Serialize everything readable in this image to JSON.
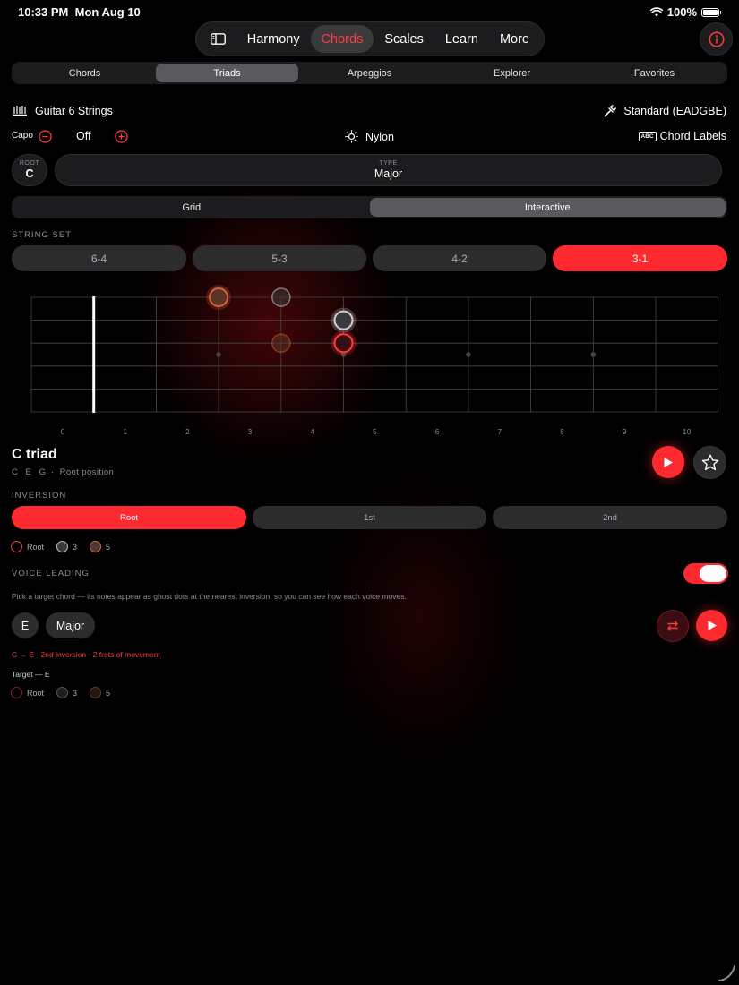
{
  "status": {
    "time": "10:33 PM",
    "date": "Mon Aug 10",
    "battery": "100%"
  },
  "nav": {
    "sidebar_icon": "sidebar-icon",
    "tabs": [
      "Harmony",
      "Chords",
      "Scales",
      "Learn",
      "More"
    ],
    "active": "Chords",
    "info_icon": "info-icon"
  },
  "subtabs": {
    "items": [
      "Chords",
      "Triads",
      "Arpeggios",
      "Explorer",
      "Favorites"
    ],
    "active": "Triads"
  },
  "instrument": {
    "label": "Guitar 6 Strings",
    "tuning": "Standard (EADGBE)"
  },
  "capo": {
    "label": "Capo",
    "value": "Off"
  },
  "string_type": "Nylon",
  "chord_labels": {
    "badge": "ABC",
    "label": "Chord Labels"
  },
  "root": {
    "label": "ROOT",
    "value": "C"
  },
  "type": {
    "label": "TYPE",
    "value": "Major"
  },
  "view_mode": {
    "items": [
      "Grid",
      "Interactive"
    ],
    "active": "Interactive"
  },
  "string_set": {
    "label": "STRING SET",
    "items": [
      "6-4",
      "5-3",
      "4-2",
      "3-1"
    ],
    "active": "3-1"
  },
  "fretboard": {
    "fret_numbers": [
      "0",
      "1",
      "2",
      "3",
      "4",
      "5",
      "6",
      "7",
      "8",
      "9",
      "10"
    ],
    "inlays": [
      3,
      5,
      7,
      9
    ],
    "notes": [
      {
        "string": 1,
        "fret": 3,
        "role": "5",
        "kind": "main"
      },
      {
        "string": 1,
        "fret": 4,
        "role": "3",
        "kind": "ghost"
      },
      {
        "string": 2,
        "fret": 5,
        "role": "3",
        "kind": "main"
      },
      {
        "string": 3,
        "fret": 4,
        "role": "5",
        "kind": "ghost"
      },
      {
        "string": 3,
        "fret": 5,
        "role": "root",
        "kind": "main"
      }
    ]
  },
  "chord": {
    "title": "C triad",
    "notes": "C E G",
    "separator": "·",
    "position": "Root position"
  },
  "inversion": {
    "label": "INVERSION",
    "items": [
      "Root",
      "1st",
      "2nd"
    ],
    "active": "Root"
  },
  "legend": [
    "Root",
    "3",
    "5"
  ],
  "voice_leading": {
    "label": "VOICE LEADING",
    "enabled": true,
    "description": "Pick a target chord — its notes appear as ghost dots at the nearest inversion, so you can see how each voice moves.",
    "target_root": "E",
    "target_type": "Major",
    "summary": "C → E · 2nd inversion · 2 frets of movement",
    "target_label": "Target — E"
  },
  "colors": {
    "accent": "#ff2a30",
    "root": "#ff3b3b",
    "third": "#8e8e93",
    "fifth": "#d9603a"
  }
}
